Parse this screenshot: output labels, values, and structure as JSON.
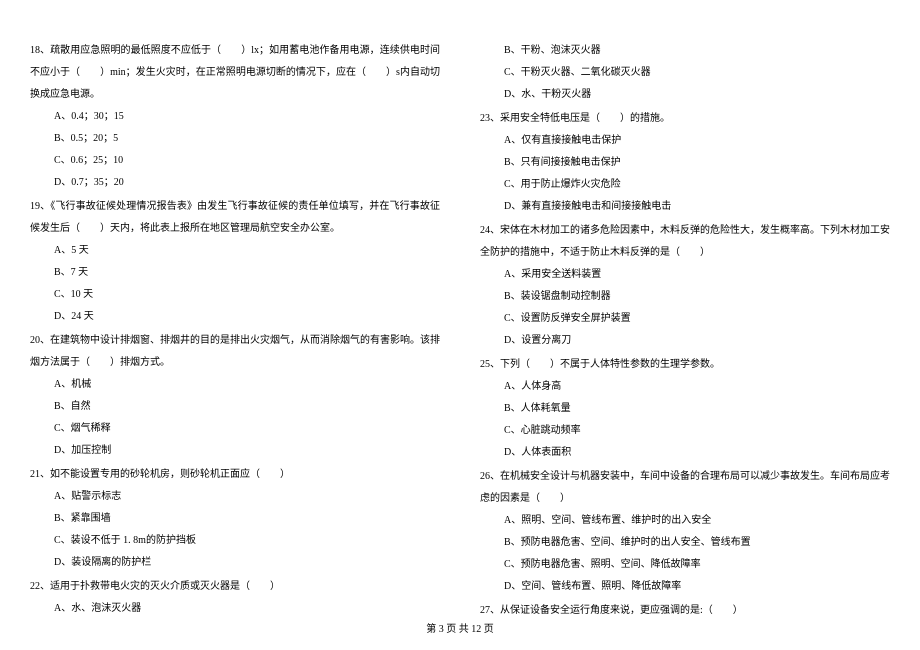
{
  "left_column": {
    "q18": {
      "text": "18、疏散用应急照明的最低照度不应低于（　　）lx；如用蓄电池作备用电源，连续供电时间不应小于（　　）min；发生火灾时，在正常照明电源切断的情况下，应在（　　）s内自动切换成应急电源。",
      "options": {
        "a": "A、0.4；30；15",
        "b": "B、0.5；20；5",
        "c": "C、0.6；25；10",
        "d": "D、0.7；35；20"
      }
    },
    "q19": {
      "text": "19、《飞行事故征候处理情况报告表》由发生飞行事故征候的责任单位填写，并在飞行事故征候发生后（　　）天内，将此表上报所在地区管理局航空安全办公室。",
      "options": {
        "a": "A、5 天",
        "b": "B、7 天",
        "c": "C、10 天",
        "d": "D、24 天"
      }
    },
    "q20": {
      "text": "20、在建筑物中设计排烟窗、排烟井的目的是排出火灾烟气，从而消除烟气的有害影响。该排烟方法属于（　　）排烟方式。",
      "options": {
        "a": "A、机械",
        "b": "B、自然",
        "c": "C、烟气稀释",
        "d": "D、加压控制"
      }
    },
    "q21": {
      "text": "21、如不能设置专用的砂轮机房，则砂轮机正面应（　　）",
      "options": {
        "a": "A、贴警示标志",
        "b": "B、紧靠围墙",
        "c": "C、装设不低于 1. 8m的防护挡板",
        "d": "D、装设隔离的防护栏"
      }
    },
    "q22": {
      "text": "22、适用于扑救带电火灾的灭火介质或灭火器是（　　）",
      "options": {
        "a": "A、水、泡沫灭火器"
      }
    }
  },
  "right_column": {
    "q22_cont": {
      "options": {
        "b": "B、干粉、泡沫灭火器",
        "c": "C、干粉灭火器、二氧化碳灭火器",
        "d": "D、水、干粉灭火器"
      }
    },
    "q23": {
      "text": "23、采用安全特低电压是（　　）的措施。",
      "options": {
        "a": "A、仅有直接接触电击保护",
        "b": "B、只有间接接触电击保护",
        "c": "C、用于防止爆炸火灾危险",
        "d": "D、兼有直接接触电击和间接接触电击"
      }
    },
    "q24": {
      "text": "24、宋体在木材加工的诸多危险因素中，木料反弹的危险性大，发生概率高。下列木材加工安全防护的措施中，不适于防止木料反弹的是（　　）",
      "options": {
        "a": "A、采用安全送料装置",
        "b": "B、装设锯盘制动控制器",
        "c": "C、设置防反弹安全屏护装置",
        "d": "D、设置分离刀"
      }
    },
    "q25": {
      "text": "25、下列（　　）不属于人体特性参数的生理学参数。",
      "options": {
        "a": "A、人体身高",
        "b": "B、人体耗氧量",
        "c": "C、心脏跳动频率",
        "d": "D、人体表面积"
      }
    },
    "q26": {
      "text": "26、在机械安全设计与机器安装中，车间中设备的合理布局可以减少事故发生。车间布局应考虑的因素是（　　）",
      "options": {
        "a": "A、照明、空间、管线布置、维护时的出入安全",
        "b": "B、预防电器危害、空间、维护时的出人安全、管线布置",
        "c": "C、预防电器危害、照明、空间、降低故障率",
        "d": "D、空间、管线布置、照明、降低故障率"
      }
    },
    "q27": {
      "text": "27、从保证设备安全运行角度来说，更应强调的是:（　　）"
    }
  },
  "footer": "第 3 页 共 12 页"
}
